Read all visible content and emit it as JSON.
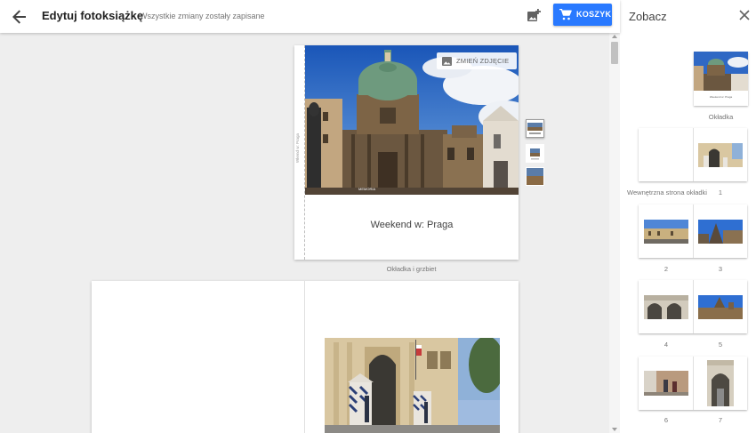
{
  "header": {
    "title": "Edytuj fotoksiążkę",
    "save_status": "Wszystkie zmiany zostały zapisane",
    "cart_label": "KOSZYK"
  },
  "cover": {
    "change_photo_label": "ZMIEŃ ZDJĘCIE",
    "title": "Weekend w: Praga",
    "spine_text": "Wkend w: Praga",
    "photo_watermark": "MEMORIA",
    "caption": "Okładka i grzbiet"
  },
  "panel": {
    "title": "Zobacz",
    "cover_label": "Okładka",
    "cover_thumb_text": "Weekend w: Praga",
    "inside_cover_label": "Wewnętrzna strona okładki",
    "pages": [
      "1",
      "2",
      "3",
      "4",
      "5",
      "6",
      "7"
    ]
  },
  "colors": {
    "accent": "#2979ff",
    "background": "#eeeeee"
  },
  "icons": {
    "back": "arrow-back-icon",
    "add_photo": "add-photo-icon",
    "cart": "cart-icon",
    "image": "image-icon",
    "close": "close-icon"
  }
}
